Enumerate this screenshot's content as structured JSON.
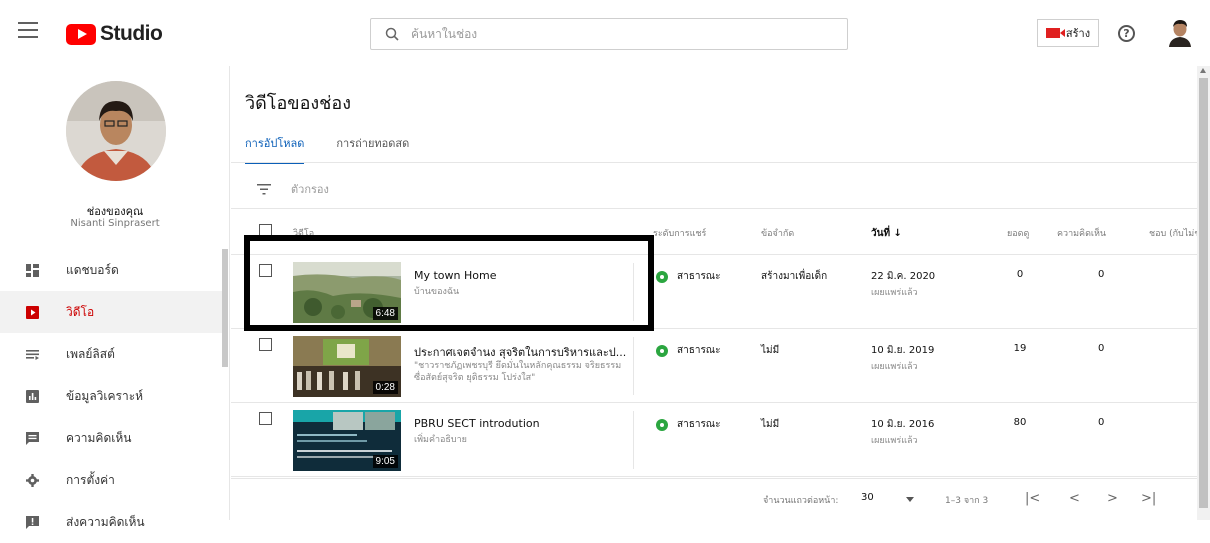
{
  "header": {
    "logo_text": "Studio",
    "search_placeholder": "ค้นหาในช่อง",
    "create_label": "สร้าง",
    "help_label": "?"
  },
  "sidebar": {
    "channel_title": "ช่องของคุณ",
    "channel_name": "Nisanti Sinprasert",
    "items": [
      {
        "label": "แดชบอร์ด",
        "icon": "dashboard-icon"
      },
      {
        "label": "วิดีโอ",
        "icon": "video-icon",
        "active": true
      },
      {
        "label": "เพลย์ลิสต์",
        "icon": "playlist-icon"
      },
      {
        "label": "ข้อมูลวิเคราะห์",
        "icon": "analytics-icon"
      },
      {
        "label": "ความคิดเห็น",
        "icon": "comments-icon"
      },
      {
        "label": "การตั้งค่า",
        "icon": "settings-icon"
      },
      {
        "label": "ส่งความคิดเห็น",
        "icon": "feedback-icon"
      }
    ]
  },
  "main": {
    "title": "วิดีโอของช่อง",
    "tabs": [
      {
        "label": "การอัปโหลด",
        "active": true
      },
      {
        "label": "การถ่ายทอดสด",
        "active": false
      }
    ],
    "filter_label": "ตัวกรอง",
    "columns": {
      "video": "วิดีโอ",
      "visibility": "ระดับการแชร์",
      "restrictions": "ข้อจำกัด",
      "date": "วันที่",
      "views": "ยอดดู",
      "comments": "ความคิดเห็น",
      "likes": "ชอบ (กับไม่ช"
    },
    "rows": [
      {
        "title": "My town Home",
        "description": "บ้านของฉัน",
        "duration": "6:48",
        "visibility": "สาธารณะ",
        "restriction": "สร้างมาเพื่อเด็ก",
        "date": "22 มิ.ค. 2020",
        "date_status": "เผยแพร่แล้ว",
        "views": "0",
        "comments": "0"
      },
      {
        "title": "ประกาศเจตจำนง สุจริตในการบริหารและป...",
        "description": "\"ชาวราชภัฏเพชรบุรี ยึดมั่นในหลักคุณธรรม จริยธรรม ซื่อสัตย์สุจริต ยุติธรรม โปร่งใส\"",
        "duration": "0:28",
        "visibility": "สาธารณะ",
        "restriction": "ไม่มี",
        "date": "10 มิ.ย. 2019",
        "date_status": "เผยแพร่แล้ว",
        "views": "19",
        "comments": "0"
      },
      {
        "title": "PBRU SECT introdution",
        "description": "เพิ่มคำอธิบาย",
        "duration": "9:05",
        "visibility": "สาธารณะ",
        "restriction": "ไม่มี",
        "date": "10 มิ.ย. 2016",
        "date_status": "เผยแพร่แล้ว",
        "views": "80",
        "comments": "0"
      }
    ],
    "footer": {
      "rows_per_page_label": "จำนวนแถวต่อหน้า:",
      "rows_per_page": "30",
      "range": "1–3 จาก 3"
    }
  },
  "colors": {
    "brand_red": "#ff0000",
    "active_blue": "#0b5fb8",
    "public_green": "#2ba640",
    "active_nav_red": "#cc0000"
  }
}
